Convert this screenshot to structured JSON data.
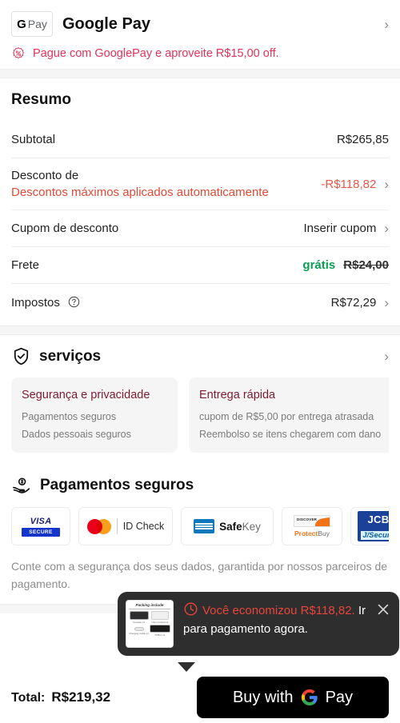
{
  "gpay_header": {
    "badge_g": "G",
    "badge_pay": "Pay",
    "title": "Google Pay",
    "chevron": "›",
    "promo_text": "Pague com GooglePay e aproveite R$15,00 off.",
    "promo_icon": "percent-badge-icon",
    "promo_color": "#e0335a"
  },
  "resumo": {
    "title": "Resumo",
    "rows": [
      {
        "label": "Subtotal",
        "value": "R$265,85",
        "has_chevron": false
      },
      {
        "label": "Desconto de",
        "sublabel": "Descontos máximos aplicados automaticamente",
        "value": "-R$118,82",
        "has_chevron": true,
        "value_color": "#e8584a"
      },
      {
        "label": "Cupom de desconto",
        "value": "Inserir cupom",
        "has_chevron": true
      },
      {
        "label": "Frete",
        "value_free": "grátis",
        "value_strike": "R$24,00",
        "has_chevron": false
      },
      {
        "label": "Impostos",
        "help_icon": "question-mark-circle-icon",
        "value": "R$72,29",
        "has_chevron": true
      }
    ]
  },
  "servicos": {
    "icon": "shield-check-icon",
    "title": "serviços",
    "chevron": "›",
    "cards": [
      {
        "heading": "Segurança e privacidade",
        "lines": [
          "Pagamentos seguros",
          "Dados pessoais seguros"
        ]
      },
      {
        "heading": "Entrega rápida",
        "lines": [
          "cupom de R$5,00 por entrega atrasada",
          "Reembolso se itens chegarem com dano"
        ]
      }
    ]
  },
  "pagamentos": {
    "icon": "hand-holding-coin-icon",
    "title": "Pagamentos seguros",
    "badges": [
      {
        "name": "visa-secure-badge",
        "line1": "VISA",
        "line2": "SECURE"
      },
      {
        "name": "mastercard-id-check-badge",
        "label": "ID Check"
      },
      {
        "name": "amex-safekey-badge",
        "label_bold": "Safe",
        "label_light": "Key"
      },
      {
        "name": "discover-protectbuy-badge",
        "top": "DISCOVER",
        "label_bold": "Protect",
        "label_light": "Buy"
      },
      {
        "name": "jcb-j-secure-badge",
        "line1": "JCB",
        "line2": "J/Secure"
      }
    ],
    "note": "Conte com a segurança dos seus dados, garantida por nossos parceiros de pagamento."
  },
  "toast": {
    "clock_icon": "clock-icon",
    "close_icon": "close-icon",
    "thumb": {
      "title": "Packing include",
      "captions": [
        "Console x1",
        "User manual x1",
        "Charging Cable x1",
        "TFBox x1"
      ]
    },
    "text_red_1": "Você economizou",
    "text_red_2": "R$118,82.",
    "text_white": "Ir para pagamento agora.",
    "red_color": "#e8453c"
  },
  "footer": {
    "total_label": "Total:",
    "total_value": "R$219,32",
    "buy_label": "Buy with",
    "buy_pay_word": "Pay",
    "google_logo": "google-g-logo-icon"
  }
}
